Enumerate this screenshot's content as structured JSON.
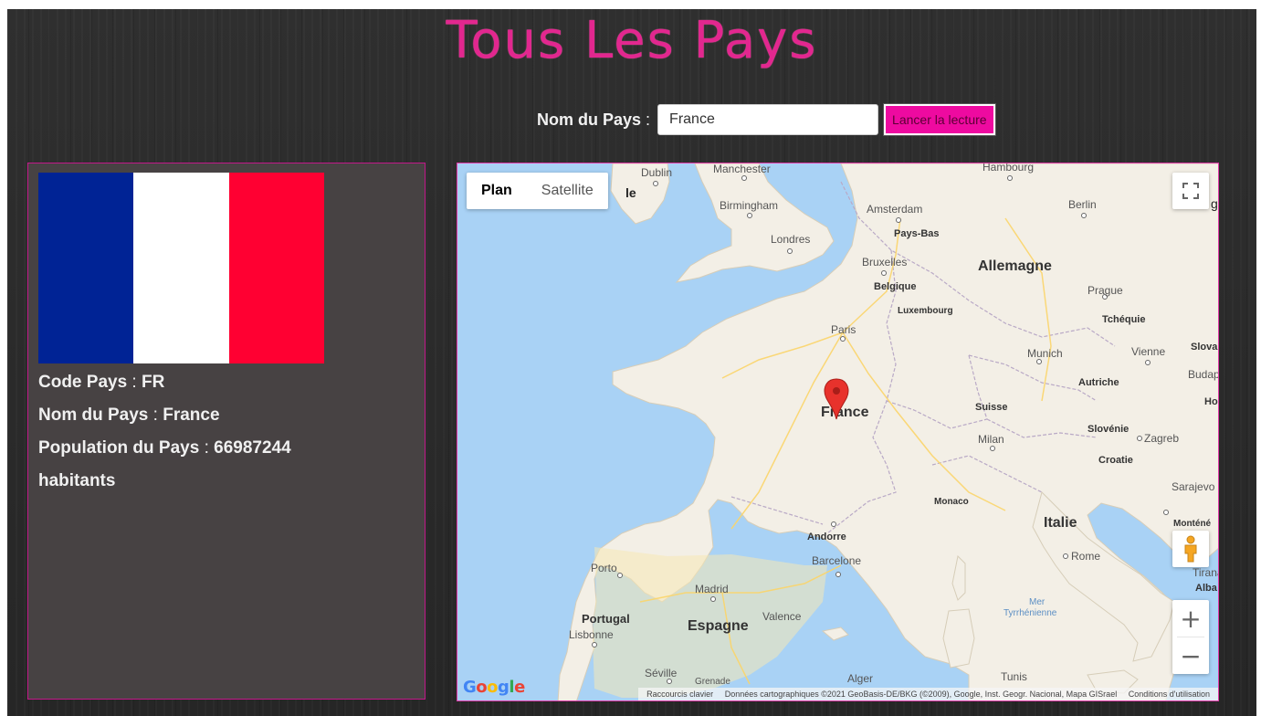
{
  "header": {
    "title": "Tous Les Pays"
  },
  "search": {
    "label": "Nom du Pays",
    "colon": " :",
    "value": "France",
    "button_label": "Lancer la lecture"
  },
  "info": {
    "code_label": "Code Pays",
    "code_value": "FR",
    "name_label": "Nom du Pays",
    "name_value": "France",
    "population_label": "Population du Pays",
    "population_value": "66987244",
    "population_unit": "habitants",
    "sep": " : ",
    "flag_colors": [
      "#002395",
      "#ffffff",
      "#ff0032"
    ]
  },
  "map": {
    "type_buttons": [
      "Plan",
      "Satellite"
    ],
    "selected_type": "Plan",
    "zoom_in": "+",
    "zoom_out": "−",
    "logo": "Google",
    "logo_colors": [
      "#4285f4",
      "#ea4335",
      "#fbbc05",
      "#4285f4",
      "#34a853",
      "#ea4335"
    ],
    "attribution": {
      "shortcuts": "Raccourcis clavier",
      "data": "Données cartographiques ©2021 GeoBasis-DE/BKG (©2009), Google, Inst. Geogr. Nacional, Mapa GISrael",
      "terms": "Conditions d'utilisation"
    },
    "labels": {
      "dublin": "Dublin",
      "manchester": "Manchester",
      "hamburg": "Hambourg",
      "birmingham": "Birmingham",
      "amsterdam": "Amsterdam",
      "berlin": "Berlin",
      "paysbas": "Pays-Bas",
      "londres": "Londres",
      "bruxelles": "Bruxelles",
      "allemagne": "Allemagne",
      "belgique": "Belgique",
      "prague": "Prague",
      "luxembourg": "Luxembourg",
      "tcheque": "Tchéquie",
      "paris": "Paris",
      "munich": "Munich",
      "vienne": "Vienne",
      "slova": "Slova",
      "autriche": "Autriche",
      "budap": "Budap",
      "hor": "Hor",
      "france": "France",
      "suisse": "Suisse",
      "slovenie": "Slovénie",
      "zagreb": "Zagreb",
      "milan": "Milan",
      "croatie": "Croatie",
      "sarajevo": "Sarajevo",
      "monaco": "Monaco",
      "montene": "Monténé",
      "italie": "Italie",
      "andorre": "Andorre",
      "rome": "Rome",
      "barcelone": "Barcelone",
      "tirana": "Tirana",
      "alba": "Alba",
      "porto": "Porto",
      "madrid": "Madrid",
      "mer": "Mer",
      "tyrrhenienne": "Tyrrhénienne",
      "portugal": "Portugal",
      "espagne": "Espagne",
      "valence": "Valence",
      "lisbonne": "Lisbonne",
      "seville": "Séville",
      "grenade": "Grenade",
      "alger": "Alger",
      "tunis": "Tunis",
      "le": "le",
      "g": "g"
    }
  }
}
